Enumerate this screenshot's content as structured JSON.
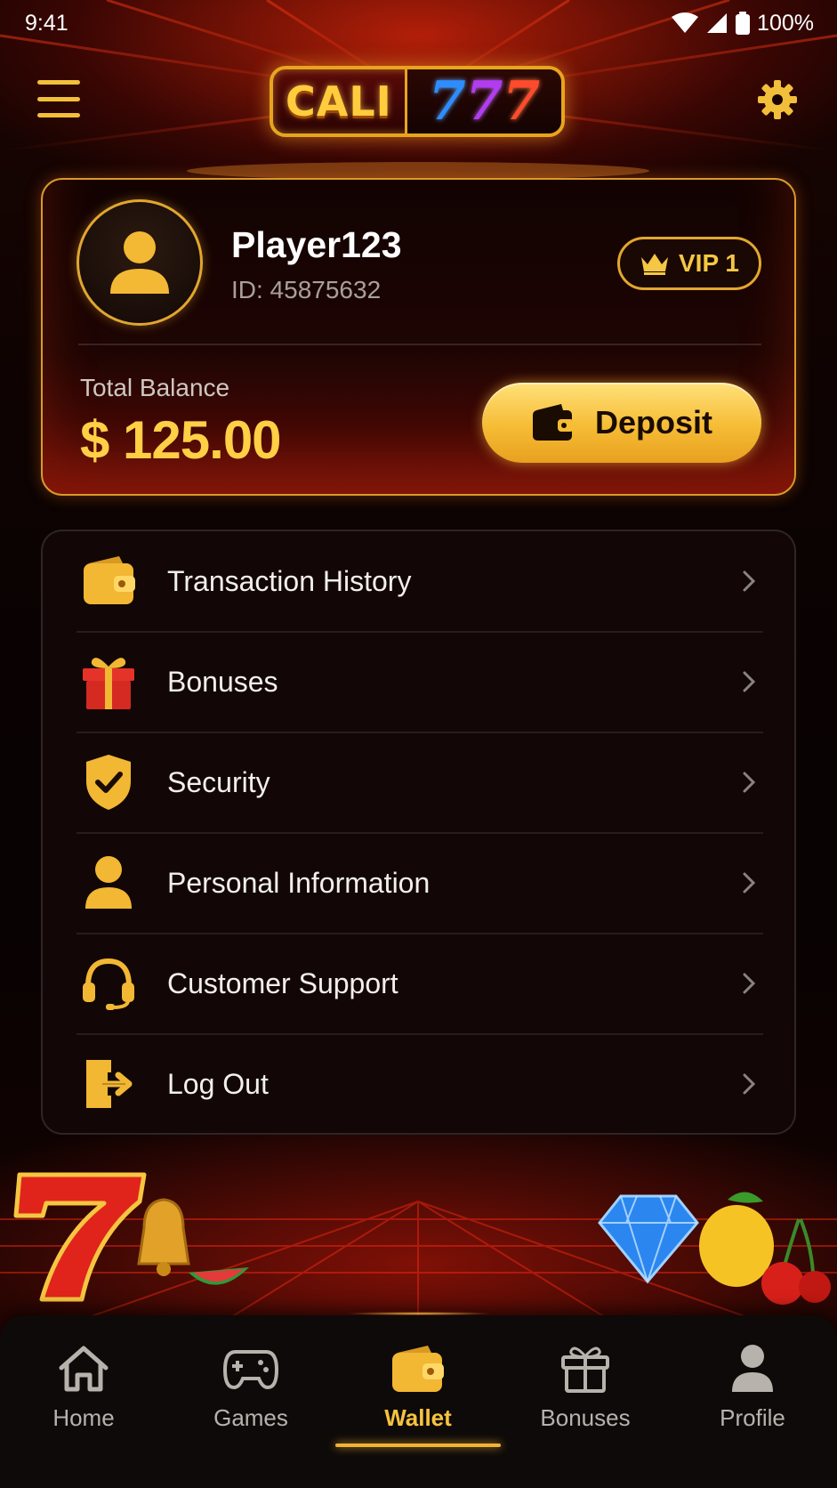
{
  "status_bar": {
    "time": "9:41",
    "battery": "100%"
  },
  "header": {
    "logo_text": "CALI",
    "logo_number": "777"
  },
  "profile": {
    "username": "Player123",
    "user_id": "ID: 45875632",
    "vip_label": "VIP 1",
    "balance_label": "Total Balance",
    "balance_amount": "$ 125.00",
    "deposit_label": "Deposit"
  },
  "menu": {
    "items": [
      {
        "label": "Transaction History",
        "icon": "wallet-icon"
      },
      {
        "label": "Bonuses",
        "icon": "gift-icon"
      },
      {
        "label": "Security",
        "icon": "shield-check-icon"
      },
      {
        "label": "Personal Information",
        "icon": "person-icon"
      },
      {
        "label": "Customer Support",
        "icon": "headset-icon"
      },
      {
        "label": "Log Out",
        "icon": "logout-icon"
      }
    ]
  },
  "bottom_nav": {
    "active": "Wallet",
    "items": [
      {
        "label": "Home",
        "icon": "home-icon"
      },
      {
        "label": "Games",
        "icon": "gamepad-icon"
      },
      {
        "label": "Wallet",
        "icon": "wallet-icon"
      },
      {
        "label": "Bonuses",
        "icon": "gift-icon"
      },
      {
        "label": "Profile",
        "icon": "person-icon"
      }
    ]
  },
  "colors": {
    "accent_gold": "#f6c33f",
    "background": "#0c0302",
    "card_border": "#d99a2b",
    "inactive_nav": "#b8b2ad"
  }
}
